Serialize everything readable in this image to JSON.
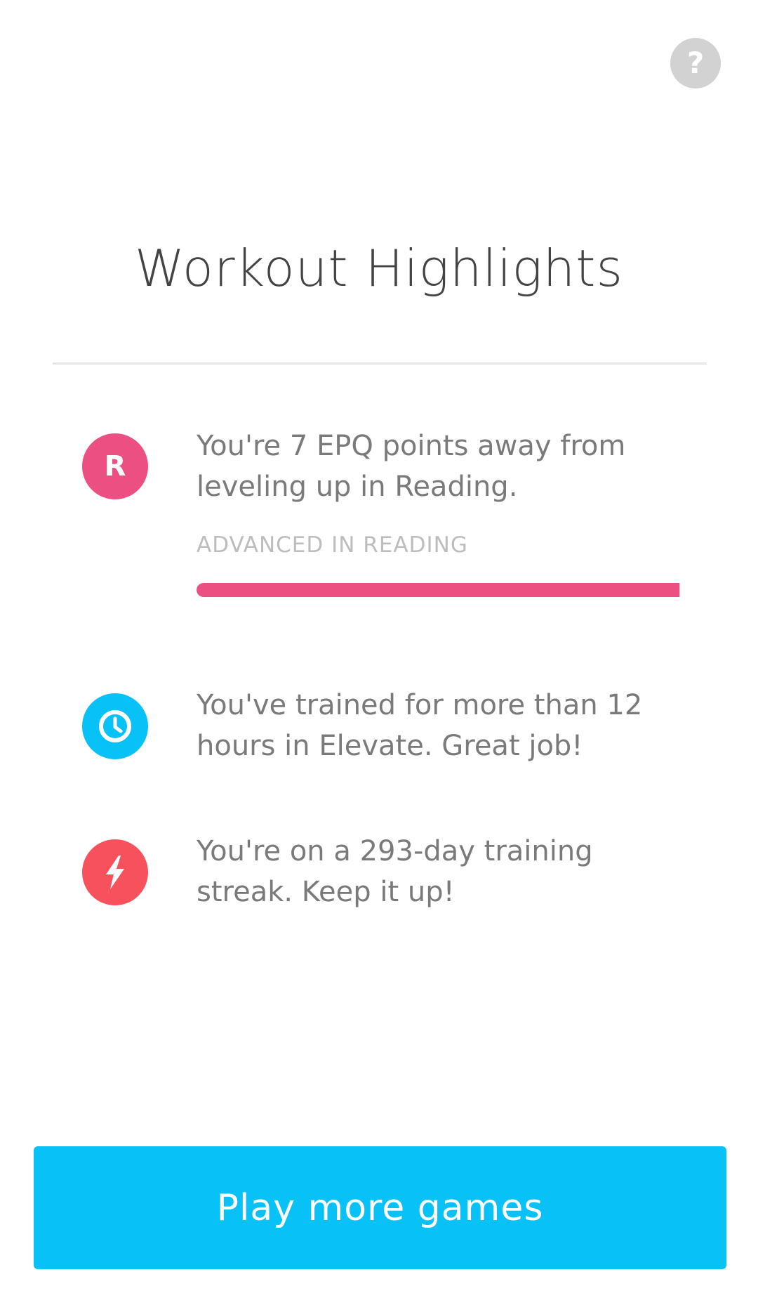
{
  "help_button": {
    "label": "?"
  },
  "header": {
    "title": "Workout Highlights"
  },
  "highlights": [
    {
      "icon": "letter-r-icon",
      "badge_letter": "R",
      "color": "#ec4f82",
      "text": "You're 7 EPQ points away from leveling up in Reading.",
      "level_label": "ADVANCED IN READING",
      "progress": 0.999
    },
    {
      "icon": "clock-icon",
      "color": "#08c2f7",
      "text": "You've trained for more than 12 hours in Elevate. Great job!"
    },
    {
      "icon": "lightning-bolt-icon",
      "color": "#f6515c",
      "text": "You're on a 293-day training streak. Keep it up!"
    }
  ],
  "footer": {
    "button_label": "Play more games"
  },
  "colors": {
    "accent": "#08c2f7",
    "reading": "#ec4f82",
    "streak": "#f6515c",
    "help_bg": "#d2d2d2"
  }
}
